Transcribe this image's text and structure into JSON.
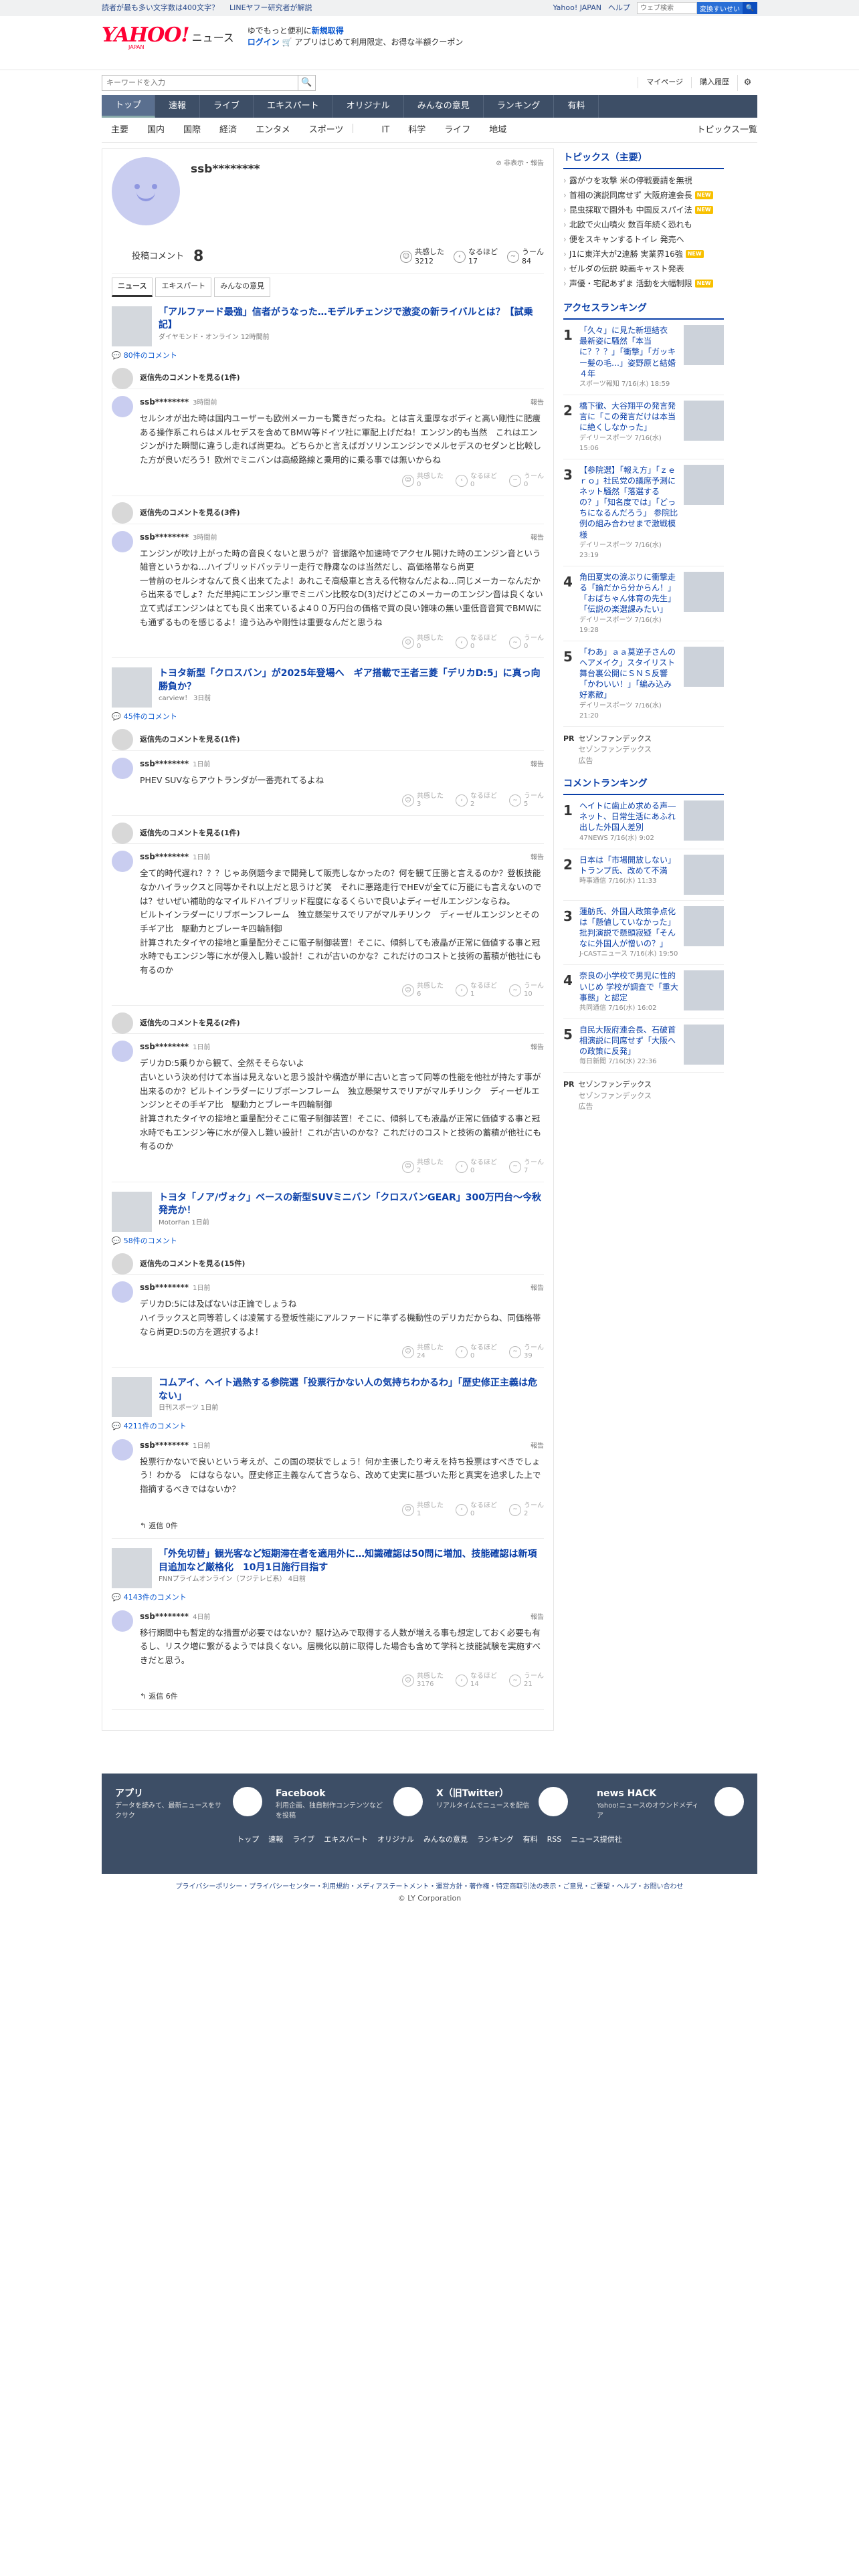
{
  "topbar": {
    "left": [
      "読者が最も多い文字数は400文字？",
      "LINEヤフー研究者が解説"
    ],
    "right": [
      "Yahoo! JAPAN",
      "ヘルプ"
    ],
    "search_placeholder": "ウェブ検索",
    "search_button": "変換すいせい"
  },
  "header": {
    "logo": "YAHOO!",
    "logo_sub": "JAPAN",
    "logo_news": "ニュース",
    "promo_line1a": "ゆでもっと便利に",
    "promo_line1b": "新規取得",
    "promo_login": "ログイン",
    "promo_line2": "アプリはじめて利用限定、お得な半額クーポン"
  },
  "search": {
    "placeholder": "キーワードを入力",
    "mypage": "マイページ",
    "history": "購入履歴"
  },
  "nav": [
    "トップ",
    "速報",
    "ライブ",
    "エキスパート",
    "オリジナル",
    "みんなの意見",
    "ランキング",
    "有料"
  ],
  "subnav": [
    "主要",
    "国内",
    "国際",
    "経済",
    "エンタメ",
    "スポーツ",
    "IT",
    "科学",
    "ライフ",
    "地域"
  ],
  "subnav_right": "トピックス一覧",
  "profile": {
    "name": "ssb********",
    "hide": "非表示・報告",
    "comments_label": "投稿コメント",
    "comments_count": "8",
    "empathy_label": "共感した",
    "empathy_count": "3212",
    "naruhodo_label": "なるほど",
    "naruhodo_count": "17",
    "uun_label": "うーん",
    "uun_count": "84"
  },
  "tabs": [
    "ニュース",
    "エキスパート",
    "みんなの意見"
  ],
  "articles": [
    {
      "title": "「アルファード最強」信者がうなった…モデルチェンジで激変の新ライバルとは？【試乗記】",
      "source": "ダイヤモンド・オンライン 12時間前",
      "count": "80件のコメント",
      "folds": [
        {
          "label": "返信先のコメントを見る(1件)"
        }
      ],
      "comments": [
        {
          "name": "ssb********",
          "time": "3時間前",
          "report": "報告",
          "text": "セルシオが出た時は国内ユーザーも欧州メーカーも驚きだったね。とは言え重厚なボディと高い剛性に肥痩ある操作系これらはメルセデスを含めてBMW等ドイツ社に軍配上げだね！エンジン的も当然　これはエンジンがけた瞬間に違うし走れば尚更ね。どちらかと言えばガソリンエンジンでメルセデスのセダンと比較した方が良いだろう！欧州でミニバンは高級路線と乗用的に乗る事では無いからね",
          "r1_label": "共感した",
          "r1": "0",
          "r2_label": "なるほど",
          "r2": "0",
          "r3_label": "うーん",
          "r3": "0"
        }
      ],
      "folds2": [
        {
          "label": "返信先のコメントを見る(3件)"
        }
      ],
      "comments2": [
        {
          "name": "ssb********",
          "time": "3時間前",
          "report": "報告",
          "text": "エンジンが吹け上がった時の音良くないと思うが？音振路や加速時でアクセル開けた時のエンジン音という雑音というかね…ハイブリッドバッテリー走行で静粛なのは当然だし、高価格帯なら尚更\n一昔前のセルシオなんて良く出来てたよ！あれこそ高級車と言える代物なんだよね…同じメーカーなんだから出来るでしょ？ただ単純にエンジン車でミニバン比較なD(3)だけどこのメーカーのエンジン音は良くない\n立て式ばエンジンはとても良く出来ているよ4００万円台の価格で買の良い雑味の無い重低音音質でBMWにも通ずるものを感じるよ！違う込みや剛性は重要なんだと思うね",
          "r1_label": "共感した",
          "r1": "0",
          "r2_label": "なるほど",
          "r2": "0",
          "r3_label": "うーん",
          "r3": "0"
        }
      ]
    },
    {
      "title": "トヨタ新型「クロスバン」が2025年登場へ　ギア搭載で王者三菱「デリカD:5」に真っ向勝負か？",
      "source": "carview！ 3日前",
      "count": "45件のコメント",
      "folds": [
        {
          "label": "返信先のコメントを見る(1件)"
        }
      ],
      "comments": [
        {
          "name": "ssb********",
          "time": "1日前",
          "report": "報告",
          "text": "PHEV SUVならアウトランダが一番売れてるよね",
          "r1_label": "共感した",
          "r1": "3",
          "r2_label": "なるほど",
          "r2": "2",
          "r3_label": "うーん",
          "r3": "5"
        }
      ],
      "folds2": [
        {
          "label": "返信先のコメントを見る(1件)"
        }
      ],
      "comments2": [
        {
          "name": "ssb********",
          "time": "1日前",
          "report": "報告",
          "text": "全て的時代遅れ？？？じゃあ例題今まで開発して販売しなかったの？何を観て圧勝と言えるのか？登板技能なかハイラックスと同等かそれ以上だと思うけど笑　それに悪路走行でHEVが全てに万能にも言えないのでは？せいぜい補助的なマイルドハイブリッド程度になるくらいで良いよディーゼルエンジンならね。\nビルトインラダーにリブボーンフレーム　独立懸架サスでリアがマルチリンク　ディーゼルエンジンとその手ギア比　駆動力とブレーキ四輪制御\n計算されたタイヤの接地と重量配分そこに電子制御装置！そこに、傾斜しても液晶が正常に価値する事と冠水時でもエンジン等に水が侵入し難い設計！これが古いのかな？これだけのコストと技術の蓄積が他社にも有るのか",
          "r1_label": "共感した",
          "r1": "6",
          "r2_label": "なるほど",
          "r2": "1",
          "r3_label": "うーん",
          "r3": "10"
        }
      ],
      "folds3": [
        {
          "label": "返信先のコメントを見る(2件)"
        }
      ],
      "comments3": [
        {
          "name": "ssb********",
          "time": "1日前",
          "report": "報告",
          "text": "デリカD:5乗りから観て、全然そそらないよ\n古いという決め付けて本当は見えないと思う設計や構造が単に古いと言って同等の性能を他社が持たす事が出来るのか？ビルトインラダーにリブボーンフレーム　独立懸架サスでリアがマルチリンク　ディーゼルエンジンとその手ギア比　駆動力とブレーキ四輪制御\n計算されたタイヤの接地と重量配分そこに電子制御装置！そこに、傾斜しても液晶が正常に価値する事と冠水時でもエンジン等に水が侵入し難い設計！これが古いのかな？これだけのコストと技術の蓄積が他社にも有るのか",
          "r1_label": "共感した",
          "r1": "2",
          "r2_label": "なるほど",
          "r2": "0",
          "r3_label": "うーん",
          "r3": "7"
        }
      ]
    },
    {
      "title": "トヨタ「ノア/ヴォク」ベースの新型SUVミニバン「クロスバンGEAR」300万円台〜今秋発売か！",
      "source": "MotorFan 1日前",
      "count": "58件のコメント",
      "folds": [
        {
          "label": "返信先のコメントを見る(15件)"
        }
      ],
      "comments": [
        {
          "name": "ssb********",
          "time": "1日前",
          "report": "報告",
          "text": "デリカD:5には及ばないは正論でしょうね\nハイラックスと同等若しくは凌駕する登坂性能にアルファードに準ずる機動性のデリカだからね、同価格帯なら尚更D:5の方を選択するよ！",
          "r1_label": "共感した",
          "r1": "24",
          "r2_label": "なるほど",
          "r2": "0",
          "r3_label": "うーん",
          "r3": "39"
        }
      ]
    },
    {
      "title": "コムアイ、ヘイト過熱する参院選「投票行かない人の気持ちわかるわ」「歴史修正主義は危ない」",
      "source": "日刊スポーツ 1日前",
      "count": "4211件のコメント",
      "comments": [
        {
          "name": "ssb********",
          "time": "1日前",
          "report": "報告",
          "text": "投票行かないで良いという考えが、この国の現状でしょう！何か主張したり考えを持ち投票はすべきでしょう！わかる　にはならない。歴史修正主義なんて言うなら、改めて史実に基づいた形と真実を追求した上で指摘するべきではないか？",
          "r1_label": "共感した",
          "r1": "1",
          "r2_label": "なるほど",
          "r2": "0",
          "r3_label": "うーん",
          "r3": "2",
          "reply": "返信 0件"
        }
      ]
    },
    {
      "title": "「外免切替」観光客など短期滞在者を適用外に…知識確認は50問に増加、技能確認は新項目追加など厳格化　10月1日施行目指す",
      "source": "FNNプライムオンライン（フジテレビ系） 4日前",
      "count": "4143件のコメント",
      "comments": [
        {
          "name": "ssb********",
          "time": "4日前",
          "report": "報告",
          "text": "移行期間中も暫定的な措置が必要ではないか？駆け込みで取得する人数が増える事も想定しておく必要も有るし、リスク増に繋がるようでは良くない。居機化以前に取得した場合も含めて学科と技能試験を実施すべきだと思う。",
          "r1_label": "共感した",
          "r1": "3176",
          "r2_label": "なるほど",
          "r2": "14",
          "r3_label": "うーん",
          "r3": "21",
          "reply": "返信 6件"
        }
      ]
    }
  ],
  "sidebar": {
    "topics_head": "トピックス（主要）",
    "topics": [
      {
        "t": "露がウを攻撃 米の停戦要請を無視",
        "tag": ""
      },
      {
        "t": "首相の演説同席せず 大阪府連会長",
        "tag": "NEW"
      },
      {
        "t": "昆虫採取で園外も 中国反スパイ法",
        "tag": "NEW"
      },
      {
        "t": "北欧で火山噴火 数百年続く恐れも",
        "tag": ""
      },
      {
        "t": "便をスキャンするトイレ 発売へ",
        "tag": ""
      },
      {
        "t": "J1に東洋大が2連勝 実業界16強",
        "tag": "NEW"
      },
      {
        "t": "ゼルダの伝説 映画キャスト発表",
        "tag": ""
      },
      {
        "t": "声優・宅配あずま 活動を大幅制限",
        "tag": "NEW"
      }
    ],
    "access_head": "アクセスランキング",
    "access": [
      {
        "n": "1",
        "t": "「久々」に見た新垣結衣　最新姿に騒然「本当に？？？」「衝撃」「ガッキー髪の毛…」姿野原と結婚４年",
        "m": "スポーツ報知 7/16(水) 18:59"
      },
      {
        "n": "2",
        "t": "橋下徹、大谷翔平の発言発言に「この発言だけは本当に絶くしなかった」",
        "m": "デイリースポーツ 7/16(水) 15:06"
      },
      {
        "n": "3",
        "t": "【参院選】「報え方」「ｚｅｒｏ」社民党の議席予測にネット騒然「落選するの？」「知名度では」「どっちになるんだろう」 参院比例の組み合わせまで激戦模様",
        "m": "デイリースポーツ 7/16(水) 23:19"
      },
      {
        "n": "4",
        "t": "角田夏実の涙ぶりに衝撃走る「論だから分からん！」「おばちゃん体育の先生」「伝説の楽選課みたい」",
        "m": "デイリースポーツ 7/16(水) 19:28"
      },
      {
        "n": "5",
        "t": "「わあ」ａａ莫逆子さんのヘアメイク」スタイリスト舞台裏公開にＳＮＳ反響「かわいい！」「編み込み好素敵」",
        "m": "デイリースポーツ 7/16(水) 21:20"
      }
    ],
    "pr1": {
      "p": "PR",
      "t": "セゾンファンデックス",
      "s": "セゾンファンデックス",
      "adv": "広告"
    },
    "comment_head": "コメントランキング",
    "comment_rank": [
      {
        "n": "1",
        "t": "ヘイトに歯止め求める声―ネット、日常生活にあふれ出した外国人差別",
        "m": "47NEWS 7/16(水) 9:02"
      },
      {
        "n": "2",
        "t": "日本は「市場開放しない」 トランプ氏、改めて不満",
        "m": "時事通信 7/16(水) 11:33"
      },
      {
        "n": "3",
        "t": "蓮舫氏、外国人政策争点化は「懸値していなかった」 批判演説で懸頭寂疑「そんなに外国人が憎いの？」",
        "m": "J-CASTニュース 7/16(水) 19:50"
      },
      {
        "n": "4",
        "t": "奈良の小学校で男児に性的いじめ 学校が調査で「重大事態」と認定",
        "m": "共同通信 7/16(水) 16:02"
      },
      {
        "n": "5",
        "t": "自民大阪府連会長、石破首相演説に同席せず「大阪への政策に反発」",
        "m": "毎日新聞 7/16(水) 22:36"
      }
    ],
    "pr2": {
      "p": "PR",
      "t": "セゾンファンデックス",
      "s": "セゾンファンデックス",
      "adv": "広告"
    }
  },
  "footer": {
    "apps": [
      {
        "name": "アプリ",
        "desc": "データを読みて、最新ニュースをサクサク"
      },
      {
        "name": "Facebook",
        "desc": "利用企画、独自制作コンテンツなどを投稿"
      },
      {
        "name": "X（旧Twitter）",
        "desc": "リアルタイムでニュースを配信"
      },
      {
        "name": "news HACK",
        "desc": "Yahoo!ニュースのオウンドメディア"
      }
    ],
    "links": [
      "トップ",
      "速報",
      "ライブ",
      "エキスパート",
      "オリジナル",
      "みんなの意見",
      "ランキング",
      "有料",
      "RSS",
      "ニュース提供社"
    ],
    "bottom": "プライバシーポリシー・プライバシーセンター・利用規約・メディアステートメント・運営方針・著作権・特定商取引法の表示・ご意見・ご要望・ヘルプ・お問い合わせ",
    "copyright": "© LY Corporation"
  }
}
